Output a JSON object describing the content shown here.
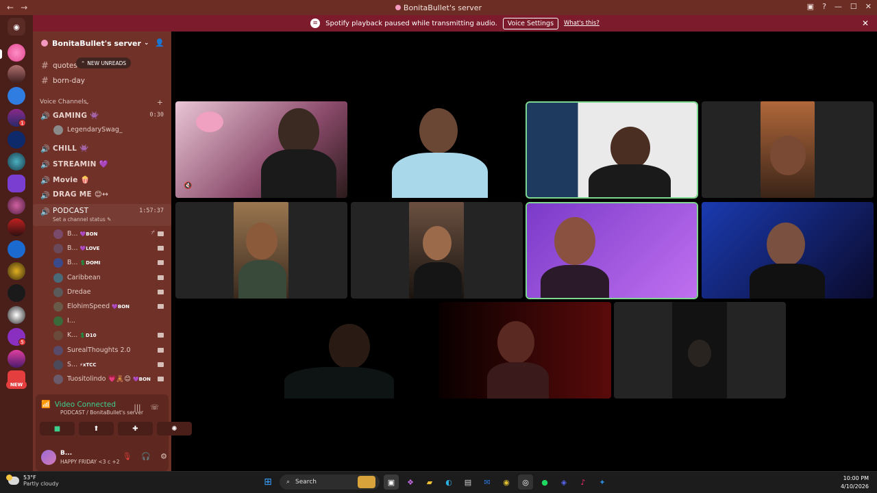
{
  "window": {
    "title": "BonitaBullet's server",
    "back": "←",
    "forward": "→"
  },
  "notice": {
    "message": "Spotify playback paused while transmitting audio.",
    "button": "Voice Settings",
    "link": "What's this?"
  },
  "server": {
    "name": "BonitaBullet's server",
    "new_unreads": "NEW UNREADS"
  },
  "text_channels": [
    {
      "name": "quotes"
    },
    {
      "name": "born-day"
    }
  ],
  "voice_category": "Voice Channels",
  "voice_channels": [
    {
      "name": "GAMING",
      "emoji": "👾",
      "timer": "0:30"
    },
    {
      "name": "CHILL",
      "emoji": "👾"
    },
    {
      "name": "STREAMIN",
      "emoji": "💜"
    },
    {
      "name": "Movie",
      "emoji": "🍿"
    },
    {
      "name": "DRAG ME",
      "emoji": "😊↔"
    },
    {
      "name": "PODCAST",
      "timer": "1:57:37",
      "status": "Set a channel status ✎"
    }
  ],
  "gaming_members": [
    {
      "name": "LegendarySwag_"
    }
  ],
  "podcast_members": [
    {
      "name": "B...",
      "tag": "💜BON",
      "color": "#7a4a6a"
    },
    {
      "name": "B...",
      "tag": "💜LOVE",
      "color": "#6a4a5a"
    },
    {
      "name": "B...",
      "tag": "💲DOMI",
      "color": "#3b4a8a"
    },
    {
      "name": "Caribbean",
      "tag": "",
      "color": "#4a6a7a"
    },
    {
      "name": "Dredae",
      "tag": "",
      "color": "#5a5a5a"
    },
    {
      "name": "ElohimSpeed",
      "tag": "💜BON",
      "color": "#6a5a4a"
    },
    {
      "name": "I...",
      "tag": "",
      "color": "#3a6a3a"
    },
    {
      "name": "K...",
      "tag": "💲D10",
      "color": "#6a4a3a"
    },
    {
      "name": "SurealThoughts 2.0",
      "tag": "",
      "color": "#5a4a6a"
    },
    {
      "name": "S...",
      "tag": "⚡xTCC",
      "color": "#4a4a5a"
    },
    {
      "name": "Tuositolindo 💗🧸😊",
      "tag": "💜BON",
      "color": "#6a5a6a"
    }
  ],
  "voice_panel": {
    "status": "Video Connected",
    "location": "PODCAST / BonitaBullet's server"
  },
  "user": {
    "name": "B...",
    "status": "HAPPY FRIDAY <3 c +2"
  },
  "rail_badges": [
    "1",
    "5"
  ],
  "rail_new": "NEW",
  "taskbar": {
    "temperature": "53°F",
    "weather": "Partly cloudy",
    "search": "Search",
    "time": "10:00 PM",
    "date": "4/10/2026"
  }
}
